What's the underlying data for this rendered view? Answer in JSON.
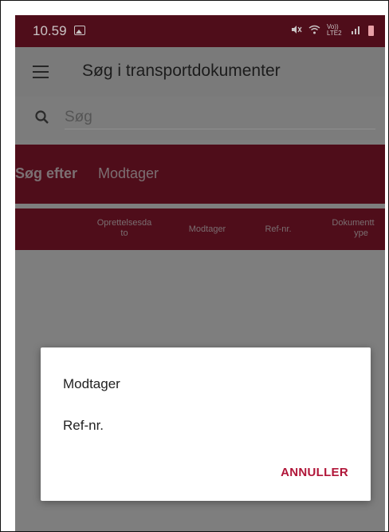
{
  "status_bar": {
    "time": "10.59",
    "network_label": "Vo)) LTE2"
  },
  "app_bar": {
    "title": "Søg i transportdokumenter"
  },
  "search": {
    "placeholder": "Søg"
  },
  "filter": {
    "label": "Søg efter",
    "value": "Modtager"
  },
  "table": {
    "columns": [
      {
        "label_line1": "Oprettelsesda",
        "label_line2": "to"
      },
      {
        "label_line1": "Modtager",
        "label_line2": ""
      },
      {
        "label_line1": "Ref-nr.",
        "label_line2": ""
      },
      {
        "label_line1": "Dokumentt",
        "label_line2": "ype"
      }
    ]
  },
  "dialog": {
    "options": [
      "Modtager",
      "Ref-nr."
    ],
    "cancel_label": "ANNULLER"
  },
  "colors": {
    "brand": "#4f0d1a",
    "accent": "#b01538"
  }
}
